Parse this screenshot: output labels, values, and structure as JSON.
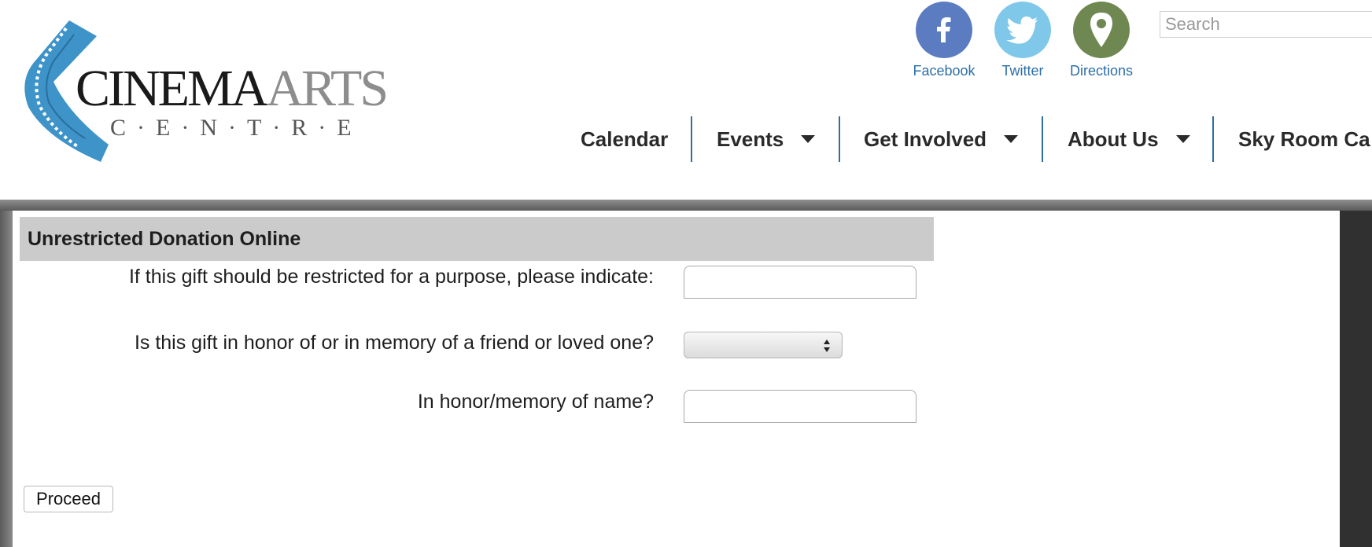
{
  "header": {
    "logo": {
      "word_cinema": "CINEMA",
      "word_arts": "ARTS",
      "word_centre": "C·E·N·T·R·E"
    },
    "social": [
      {
        "label": "Facebook",
        "icon": "facebook-icon",
        "color": "#5b7cc1"
      },
      {
        "label": "Twitter",
        "icon": "twitter-icon",
        "color": "#7fc8ea"
      },
      {
        "label": "Directions",
        "icon": "map-pin-icon",
        "color": "#6f8750"
      }
    ],
    "search": {
      "placeholder": "Search",
      "value": ""
    },
    "nav": [
      {
        "label": "Calendar",
        "has_dropdown": false
      },
      {
        "label": "Events",
        "has_dropdown": true
      },
      {
        "label": "Get Involved",
        "has_dropdown": true
      },
      {
        "label": "About Us",
        "has_dropdown": true
      },
      {
        "label": "Sky Room Ca",
        "has_dropdown": false
      }
    ],
    "accent_color": "#2f6e9e"
  },
  "form": {
    "title": "Unrestricted Donation Online",
    "fields": [
      {
        "label": "If this gift should be restricted for a purpose, please indicate:",
        "type": "text",
        "value": ""
      },
      {
        "label": "Is this gift in honor of or in memory of a friend or loved one?",
        "type": "select",
        "value": ""
      },
      {
        "label": "In honor/memory of name?",
        "type": "text",
        "value": ""
      }
    ],
    "submit_label": "Proceed"
  }
}
